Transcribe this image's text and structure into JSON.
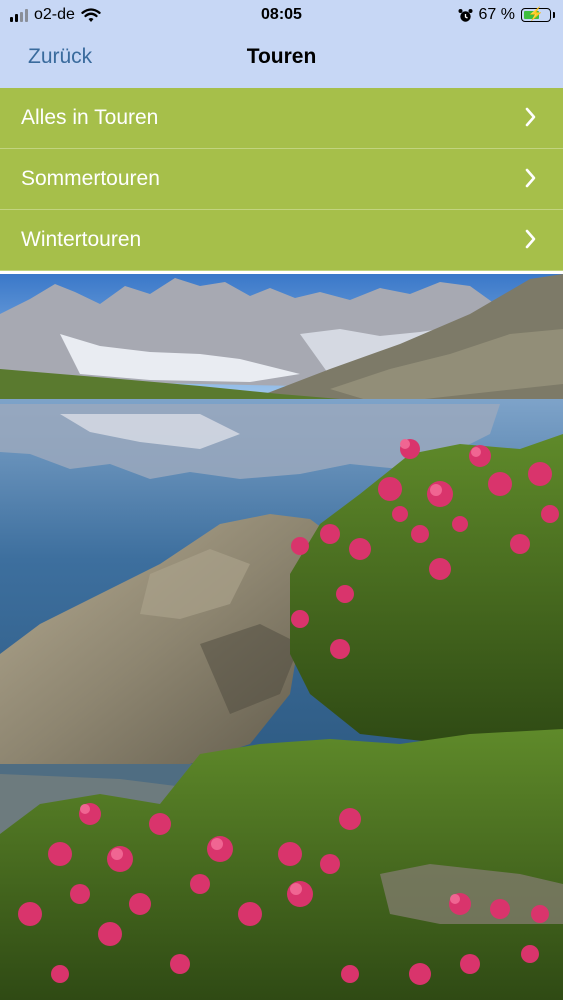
{
  "status_bar": {
    "carrier": "o2-de",
    "time": "08:05",
    "battery_percent": "67 %",
    "battery_level": 0.67,
    "icons": [
      "signal-icon",
      "wifi-icon",
      "alarm-icon",
      "battery-icon"
    ]
  },
  "nav": {
    "back_label": "Zurück",
    "title": "Touren"
  },
  "menu": {
    "items": [
      {
        "label": "Alles in Touren"
      },
      {
        "label": "Sommertouren"
      },
      {
        "label": "Wintertouren"
      }
    ]
  },
  "colors": {
    "nav_background": "#c7d7f5",
    "back_link": "#3a6b9d",
    "menu_background": "#a6bf4a",
    "menu_text": "#ffffff"
  },
  "image": {
    "subject": "alpine-lake-with-alpenrose"
  }
}
